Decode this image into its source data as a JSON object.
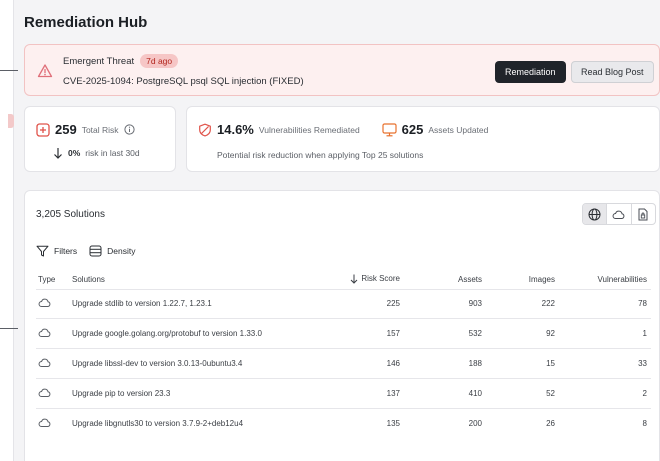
{
  "page": {
    "title": "Remediation Hub"
  },
  "alert": {
    "title": "Emergent Threat",
    "badge": "7d ago",
    "description": "CVE-2025-1094: PostgreSQL psql SQL injection (FIXED)",
    "primary_button": "Remediation",
    "secondary_button": "Read Blog Post",
    "icon": "warning-triangle-icon"
  },
  "risk_card": {
    "value": "259",
    "label": "Total Risk",
    "change": "0%",
    "change_label": "risk in last 30d"
  },
  "vuln_card": {
    "percent": "14.6%",
    "percent_label": "Vulnerabilities Remediated",
    "assets": "625",
    "assets_label": "Assets Updated",
    "note": "Potential risk reduction when applying Top 25 solutions"
  },
  "solutions": {
    "count": "3,205 Solutions",
    "filters_label": "Filters",
    "density_label": "Density",
    "columns": {
      "type": "Type",
      "solutions": "Solutions",
      "risk": "Risk Score",
      "assets": "Assets",
      "images": "Images",
      "vulnerabilities": "Vulnerabilities"
    },
    "rows": [
      {
        "solution": "Upgrade stdlib to version 1.22.7, 1.23.1",
        "risk": "225",
        "assets": "903",
        "images": "222",
        "vulnerabilities": "78"
      },
      {
        "solution": "Upgrade google.golang.org/protobuf to version 1.33.0",
        "risk": "157",
        "assets": "532",
        "images": "92",
        "vulnerabilities": "1"
      },
      {
        "solution": "Upgrade libssl-dev to version 3.0.13-0ubuntu3.4",
        "risk": "146",
        "assets": "188",
        "images": "15",
        "vulnerabilities": "33"
      },
      {
        "solution": "Upgrade pip to version 23.3",
        "risk": "137",
        "assets": "410",
        "images": "52",
        "vulnerabilities": "2"
      },
      {
        "solution": "Upgrade libgnutls30 to version 3.7.9-2+deb12u4",
        "risk": "135",
        "assets": "200",
        "images": "26",
        "vulnerabilities": "8"
      }
    ]
  },
  "colors": {
    "alert_bg": "#fdf0f0",
    "alert_accent": "#e0707a",
    "risk_icon": "#e0534a",
    "asset_icon": "#e8722e",
    "dark_button": "#20242a"
  }
}
